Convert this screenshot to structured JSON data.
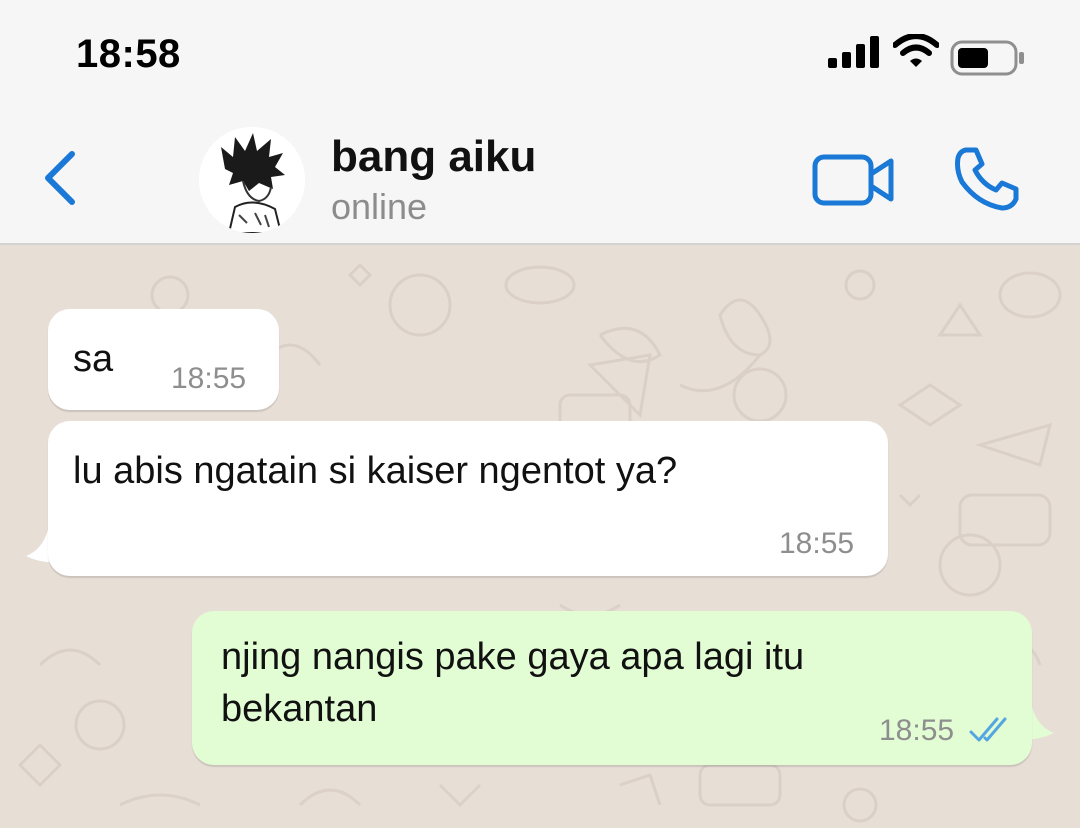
{
  "status_bar": {
    "time": "18:58",
    "signal_icon": "signal-bars-icon",
    "wifi_icon": "wifi-icon",
    "battery_icon": "battery-icon"
  },
  "header": {
    "back_icon": "chevron-left-icon",
    "contact_name": "bang aiku",
    "contact_status": "online",
    "video_icon": "video-camera-icon",
    "call_icon": "phone-icon"
  },
  "colors": {
    "accent": "#1a78d6",
    "incoming_bubble": "#ffffff",
    "outgoing_bubble": "#e2fdd4",
    "wallpaper": "#e7ded6",
    "read_ticks": "#53a6e0"
  },
  "messages": [
    {
      "direction": "incoming",
      "text": "sa",
      "time": "18:55"
    },
    {
      "direction": "incoming",
      "text": "lu abis ngatain si kaiser ngentot ya?",
      "time": "18:55"
    },
    {
      "direction": "outgoing",
      "lines": [
        "njing nangis pake gaya apa lagi itu",
        "bekantan"
      ],
      "time": "18:55",
      "status_icon": "double-check-read-icon"
    }
  ]
}
